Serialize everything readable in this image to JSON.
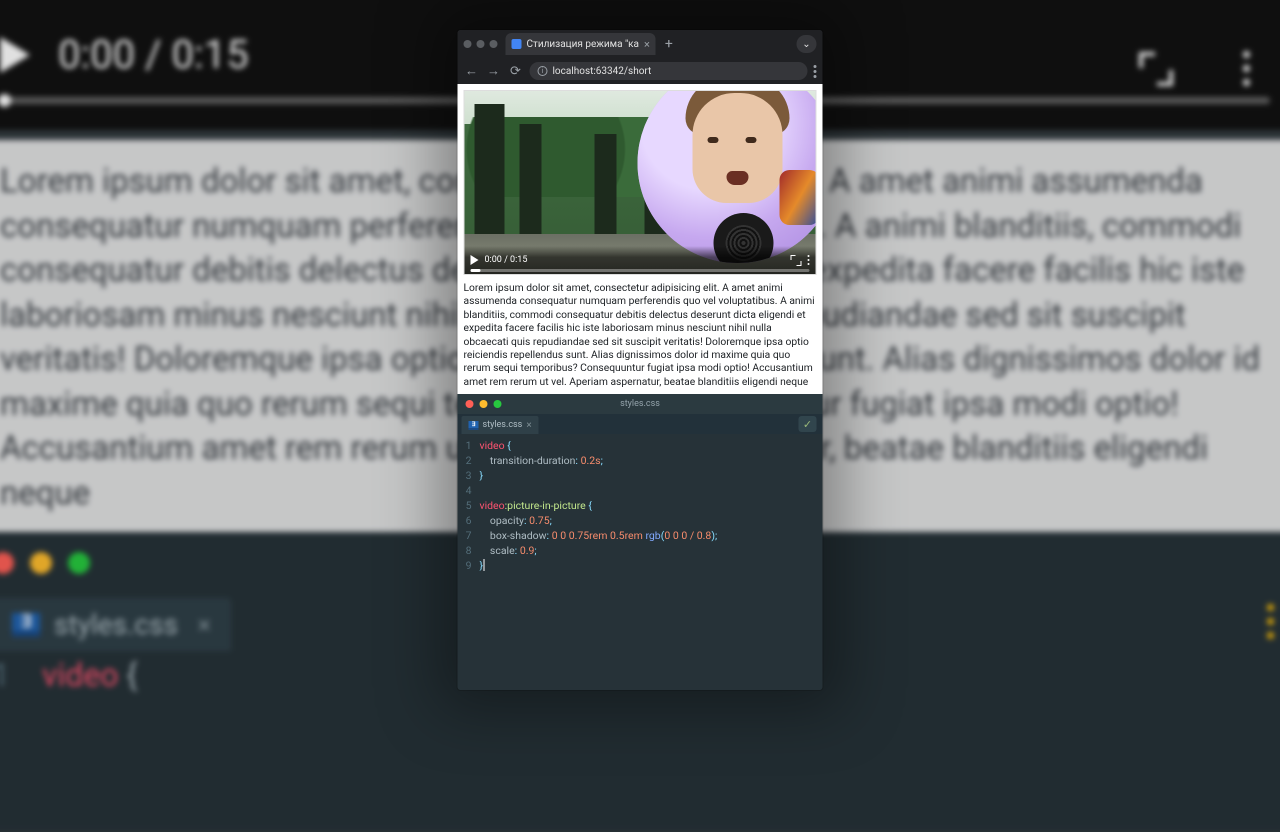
{
  "browser": {
    "tab_title": "Стилизация режима \"ка",
    "url_host": "localhost:63342/short",
    "new_tab_label": "+",
    "nav": {
      "back_glyph": "←",
      "forward_glyph": "→",
      "reload_glyph": "⟳"
    },
    "chevron_glyph": "⌄"
  },
  "video": {
    "time": "0:00 / 0:15"
  },
  "page": {
    "lorem": "Lorem ipsum dolor sit amet, consectetur adipisicing elit. A amet animi assumenda consequatur numquam perferendis quo vel voluptatibus. A animi blanditiis, commodi consequatur debitis delectus deserunt dicta eligendi et expedita facere facilis hic iste laboriosam minus nesciunt nihil nulla obcaecati quis repudiandae sed sit suscipit veritatis! Doloremque ipsa optio reiciendis repellendus sunt. Alias dignissimos dolor id maxime quia quo rerum sequi temporibus? Consequuntur fugiat ipsa modi optio! Accusantium amet rem rerum ut vel. Aperiam aspernatur, beatae blanditiis eligendi neque"
  },
  "editor": {
    "filename": "styles.css",
    "tab_label": "styles.css",
    "badge": "∃",
    "checkmark": "✓",
    "lines": {
      "1": {
        "selector": "video",
        "brace": " {"
      },
      "2": {
        "prop": "transition-duration",
        "val": "0.2s"
      },
      "3": {
        "brace": "}"
      },
      "5": {
        "selector": "video",
        "pseudo": ":picture-in-picture",
        "brace": " {"
      },
      "6": {
        "prop": "opacity",
        "val": "0.75"
      },
      "7": {
        "prop": "box-shadow",
        "val1": "0 0 0.75rem 0.5rem ",
        "fn": "rgb",
        "args": "0 0 0 / 0.8"
      },
      "8": {
        "prop": "scale",
        "val": "0.9"
      },
      "9": {
        "brace": "}"
      }
    }
  },
  "bg": {
    "time": "0:00 / 0:15",
    "lorem": "Lorem ipsum dolor sit amet, consectetur adipisicing elit. A amet animi assumenda consequatur numquam perferendis quo vel voluptatibus. A animi blanditiis, commodi consequatur debitis delectus deserunt dicta eligendi et expedita facere facilis hic iste laboriosam minus nesciunt nihil nulla obcaecati quis repudiandae sed sit suscipit veritatis! Doloremque ipsa optio reiciendis repellendus sunt. Alias dignissimos dolor id maxime quia quo rerum sequi temporibus? Consequuntur fugiat ipsa modi optio! Accusantium amet rem rerum ut vel. Aperiam aspernatur, beatae blanditiis eligendi neque",
    "tab_label": "styles.css",
    "code_kw": "video",
    "code_brace": " {"
  }
}
